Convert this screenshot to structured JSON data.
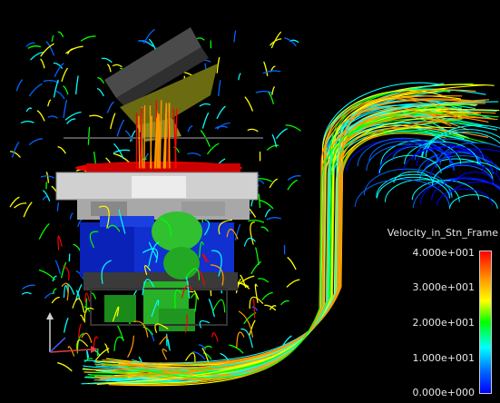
{
  "legend": {
    "title": "Velocity_in_Stn_Frame",
    "ticks": [
      "4.000e+001",
      "3.000e+001",
      "2.000e+001",
      "1.000e+001",
      "0.000e+000"
    ],
    "colors": [
      "#ff0000",
      "#ff9a00",
      "#ffff00",
      "#00ff00",
      "#00ffff",
      "#0066ff",
      "#0000ff"
    ]
  },
  "triad": {
    "axes": [
      "x-axis",
      "y-axis",
      "z-axis"
    ]
  }
}
